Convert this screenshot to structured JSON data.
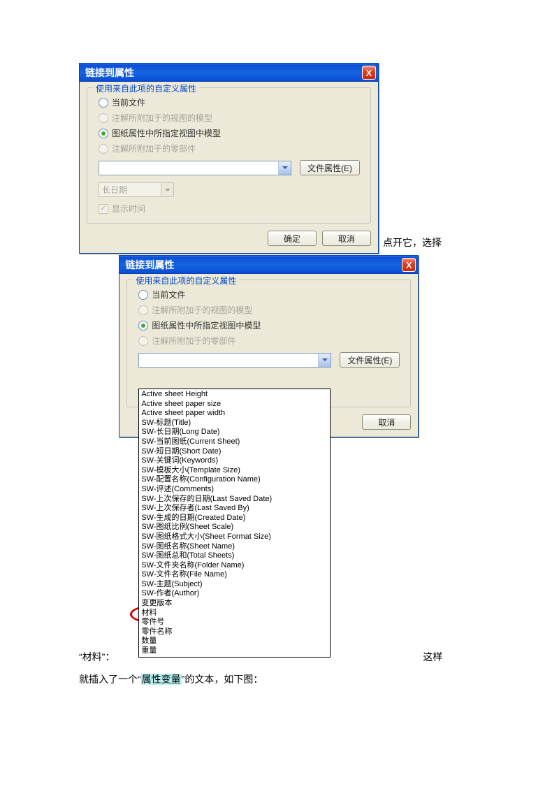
{
  "dialog": {
    "title": "链接到属性",
    "close": "X",
    "group_legend": "使用来自此项的自定义属性",
    "radios": {
      "r1": "当前文件",
      "r2": "注解所附加于的视图的模型",
      "r3": "图纸属性中所指定视图中模型",
      "r4": "注解所附加于的零部件"
    },
    "file_attr_btn": "文件属性(E)",
    "date_format": "长日期",
    "show_time": "显示时间",
    "ok": "确定",
    "cancel": "取消"
  },
  "dropdown_options": [
    "Active sheet Height",
    "Active sheet paper size",
    "Active sheet paper width",
    "SW-标题(Title)",
    "SW-长日期(Long Date)",
    "SW-当前图纸(Current Sheet)",
    "SW-短日期(Short Date)",
    "SW-关键词(Keywords)",
    "SW-模板大小(Template Size)",
    "SW-配置名称(Configuration Name)",
    "SW-评述(Comments)",
    "SW-上次保存的日期(Last Saved Date)",
    "SW-上次保存者(Last Saved By)",
    "SW-生成的日期(Created Date)",
    "SW-图纸比例(Sheet Scale)",
    "SW-图纸格式大小(Sheet Format Size)",
    "SW-图纸名称(Sheet Name)",
    "SW-图纸总和(Total Sheets)",
    "SW-文件夹名称(Folder Name)",
    "SW-文件名称(File Name)",
    "SW-主题(Subject)",
    "SW-作者(Author)",
    "变更版本",
    "材料",
    "零件号",
    "零件名称",
    "数量",
    "重量"
  ],
  "doc_text": {
    "after_img1": "点开它，选择",
    "before_img2": "“材料”：",
    "after_img2": "这样",
    "final_prefix": "就插入了一个“",
    "final_highlight": "属性变量",
    "final_suffix": "”的文本，如下图："
  }
}
